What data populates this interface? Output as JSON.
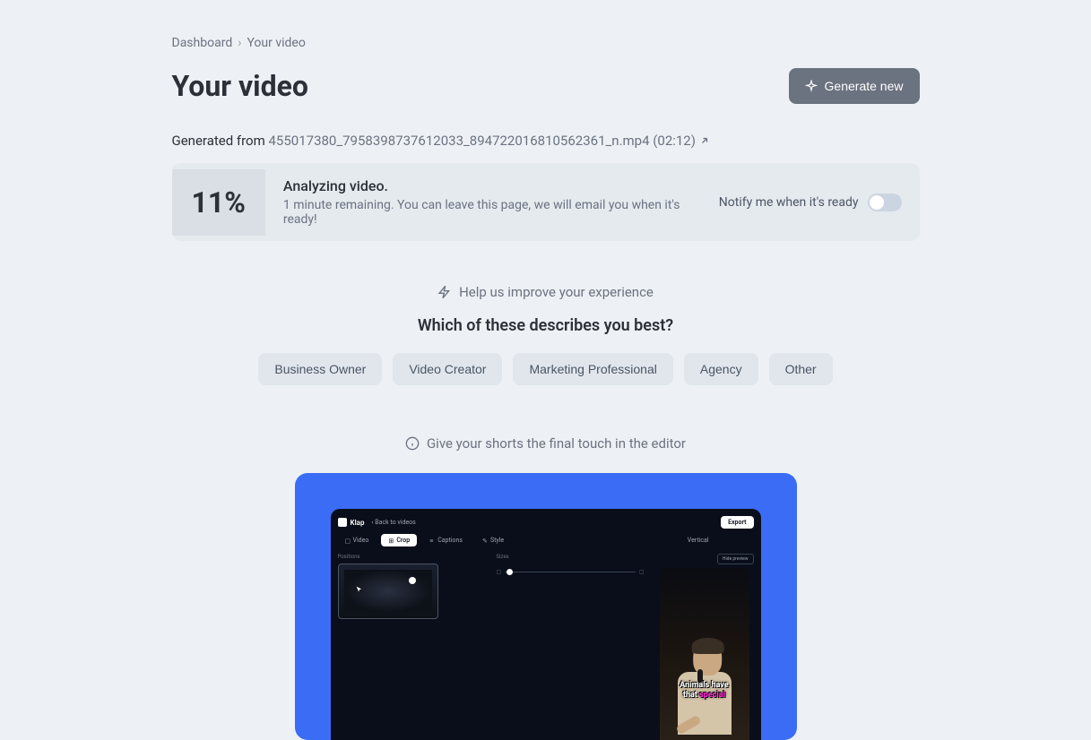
{
  "breadcrumb": {
    "items": [
      "Dashboard",
      "Your video"
    ]
  },
  "header": {
    "title": "Your video",
    "generate_button": "Generate new"
  },
  "source": {
    "prefix": "Generated from ",
    "filename": "455017380_7958398737612033_894722016810562361_n.mp4 (02:12)"
  },
  "progress": {
    "percent": "11%",
    "title": "Analyzing video.",
    "subtitle": "1 minute remaining. You can leave this page, we will email you when it's ready!",
    "notify_label": "Notify me when it's ready"
  },
  "survey": {
    "header": "Help us improve your experience",
    "question": "Which of these describes you best?",
    "options": [
      "Business Owner",
      "Video Creator",
      "Marketing Professional",
      "Agency",
      "Other"
    ]
  },
  "editor": {
    "header": "Give your shorts the final touch in the editor",
    "logo": "Klap",
    "back": "Back to videos",
    "export": "Export",
    "tabs": [
      "Video",
      "Crop",
      "Captions",
      "Style"
    ],
    "vertical_label": "Vertical",
    "sections": {
      "positions": "Positions",
      "sizes": "Sizes"
    },
    "hide_preview": "Hide preview",
    "caption_line1": "Animals have",
    "caption_line2_a": "that ",
    "caption_line2_b": "special"
  }
}
